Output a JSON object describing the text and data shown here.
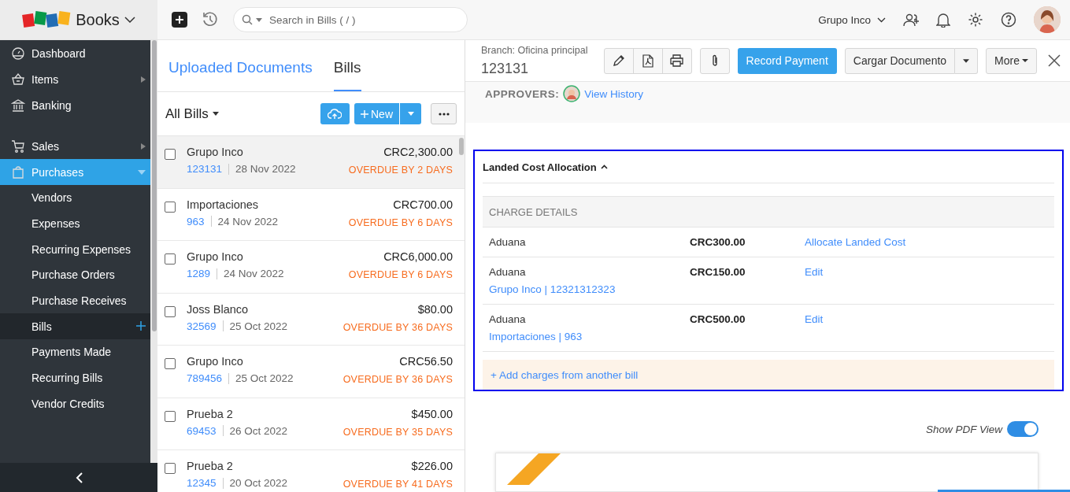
{
  "app": {
    "brand": "Books"
  },
  "topbar": {
    "search_placeholder": "Search in Bills ( / )",
    "organization": "Grupo Inco"
  },
  "sidebar": {
    "sections": [
      [
        {
          "label": "Dashboard",
          "selected": false
        },
        {
          "label": "Items",
          "selected": false,
          "expanded": false
        },
        {
          "label": "Banking",
          "selected": false
        }
      ],
      [
        {
          "label": "Sales",
          "selected": false,
          "expanded": false
        },
        {
          "label": "Purchases",
          "selected": true,
          "expanded": true,
          "children": [
            {
              "label": "Vendors",
              "selected": false
            },
            {
              "label": "Expenses",
              "selected": false
            },
            {
              "label": "Recurring Expenses",
              "selected": false
            },
            {
              "label": "Purchase Orders",
              "selected": false
            },
            {
              "label": "Purchase Receives",
              "selected": false
            },
            {
              "label": "Bills",
              "selected": true
            },
            {
              "label": "Payments Made",
              "selected": false
            },
            {
              "label": "Recurring Bills",
              "selected": false
            },
            {
              "label": "Vendor Credits",
              "selected": false
            }
          ]
        }
      ]
    ]
  },
  "list": {
    "tabs": [
      {
        "label": "Uploaded Documents",
        "selected": false
      },
      {
        "label": "Bills",
        "selected": true
      }
    ],
    "filter": "All Bills",
    "new_button": "New",
    "rows": [
      {
        "vendor": "Grupo Inco",
        "number": "123131",
        "date": "28 Nov 2022",
        "amount": "CRC2,300.00",
        "status": "OVERDUE BY 2 DAYS",
        "selected": true,
        "checked": false
      },
      {
        "vendor": "Importaciones",
        "number": "963",
        "date": "24 Nov 2022",
        "amount": "CRC700.00",
        "status": "OVERDUE BY 6 DAYS",
        "selected": false,
        "checked": false
      },
      {
        "vendor": "Grupo Inco",
        "number": "1289",
        "date": "24 Nov 2022",
        "amount": "CRC6,000.00",
        "status": "OVERDUE BY 6 DAYS",
        "selected": false,
        "checked": false
      },
      {
        "vendor": "Joss Blanco",
        "number": "32569",
        "date": "25 Oct 2022",
        "amount": "$80.00",
        "status": "OVERDUE BY 36 DAYS",
        "selected": false,
        "checked": false
      },
      {
        "vendor": "Grupo Inco",
        "number": "789456",
        "date": "25 Oct 2022",
        "amount": "CRC56.50",
        "status": "OVERDUE BY 36 DAYS",
        "selected": false,
        "checked": false
      },
      {
        "vendor": "Prueba 2",
        "number": "69453",
        "date": "26 Oct 2022",
        "amount": "$450.00",
        "status": "OVERDUE BY 35 DAYS",
        "selected": false,
        "checked": false
      },
      {
        "vendor": "Prueba 2",
        "number": "12345",
        "date": "20 Oct 2022",
        "amount": "$226.00",
        "status": "OVERDUE BY 41 DAYS",
        "selected": false,
        "checked": false
      }
    ]
  },
  "detail": {
    "branch": "Branch: Oficina principal",
    "number": "123131",
    "record_payment": "Record Payment",
    "upload_button": "Cargar Documento",
    "more_button": "More",
    "approvers_label": "APPROVERS:",
    "view_history": "View History",
    "landed_cost": {
      "title": "Landed Cost Allocation",
      "expanded": true,
      "header": "CHARGE DETAILS",
      "charges": [
        {
          "name": "Aduana",
          "amount": "CRC300.00",
          "action": "Allocate Landed Cost"
        },
        {
          "name": "Aduana",
          "amount": "CRC150.00",
          "action": "Edit",
          "bill": "Grupo Inco | 12321312323"
        },
        {
          "name": "Aduana",
          "amount": "CRC500.00",
          "action": "Edit",
          "bill": "Importaciones | 963"
        }
      ],
      "add_link": "+ Add charges from another bill"
    },
    "pdf_toggle": {
      "label": "Show PDF View",
      "on": true
    }
  }
}
